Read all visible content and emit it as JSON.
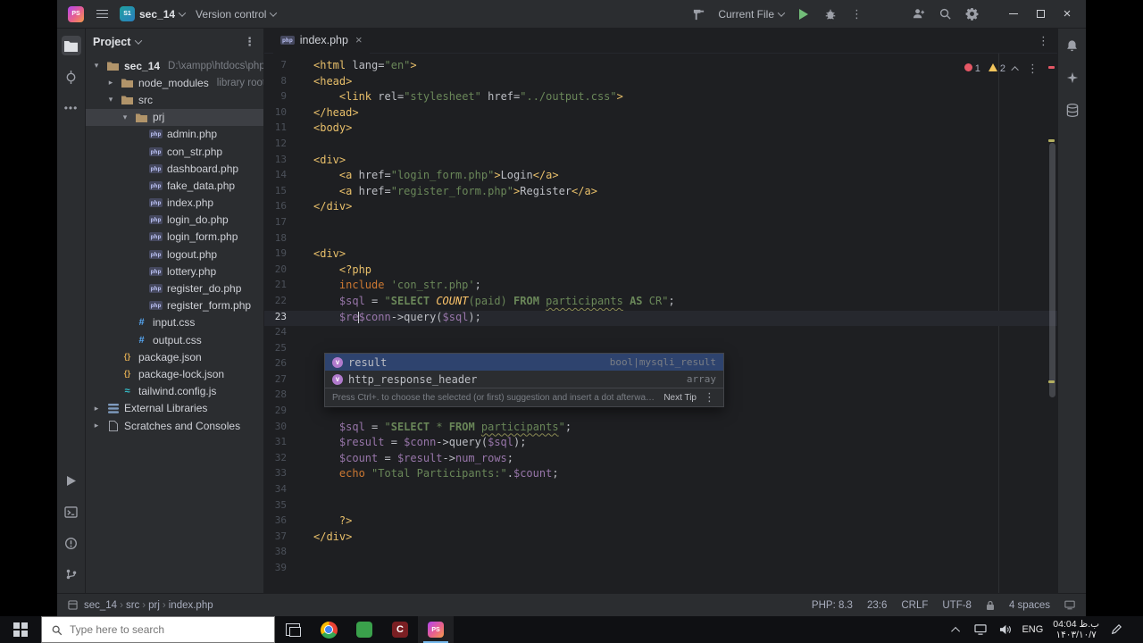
{
  "title_bar": {
    "project_initials": "S1",
    "project_name": "sec_14",
    "version_control_label": "Version control",
    "run_config_label": "Current File",
    "logo_text": "PS"
  },
  "editor_tabs": {
    "active_tab": "index.php",
    "active_tab_icon": "php"
  },
  "inspections": {
    "errors": "1",
    "warnings": "2"
  },
  "project_panel": {
    "header": "Project",
    "items": [
      {
        "label": "sec_14",
        "hint": "D:\\xampp\\htdocs\\php_c",
        "indent": 0,
        "type": "folder",
        "chevron": "open",
        "bold": true
      },
      {
        "label": "node_modules",
        "hint": "library root",
        "indent": 1,
        "type": "folder",
        "chevron": "closed"
      },
      {
        "label": "src",
        "indent": 1,
        "type": "folder",
        "chevron": "open"
      },
      {
        "label": "prj",
        "indent": 2,
        "type": "folder",
        "chevron": "open",
        "selected": true
      },
      {
        "label": "admin.php",
        "indent": 3,
        "type": "php"
      },
      {
        "label": "con_str.php",
        "indent": 3,
        "type": "php"
      },
      {
        "label": "dashboard.php",
        "indent": 3,
        "type": "php"
      },
      {
        "label": "fake_data.php",
        "indent": 3,
        "type": "php"
      },
      {
        "label": "index.php",
        "indent": 3,
        "type": "php"
      },
      {
        "label": "login_do.php",
        "indent": 3,
        "type": "php"
      },
      {
        "label": "login_form.php",
        "indent": 3,
        "type": "php"
      },
      {
        "label": "logout.php",
        "indent": 3,
        "type": "php"
      },
      {
        "label": "lottery.php",
        "indent": 3,
        "type": "php"
      },
      {
        "label": "register_do.php",
        "indent": 3,
        "type": "php"
      },
      {
        "label": "register_form.php",
        "indent": 3,
        "type": "php"
      },
      {
        "label": "input.css",
        "indent": 2,
        "type": "css"
      },
      {
        "label": "output.css",
        "indent": 2,
        "type": "css"
      },
      {
        "label": "package.json",
        "indent": 1,
        "type": "json"
      },
      {
        "label": "package-lock.json",
        "indent": 1,
        "type": "json"
      },
      {
        "label": "tailwind.config.js",
        "indent": 1,
        "type": "tw"
      },
      {
        "label": "External Libraries",
        "indent": 0,
        "type": "lib",
        "chevron": "closed"
      },
      {
        "label": "Scratches and Consoles",
        "indent": 0,
        "type": "scratch",
        "chevron": "closed"
      }
    ]
  },
  "editor": {
    "current_line": 23,
    "lines": [
      {
        "n": 7,
        "tk": [
          [
            "tag",
            "<html "
          ],
          [
            "attr",
            "lang"
          ],
          [
            "txt",
            "="
          ],
          [
            "str",
            "\"en\""
          ],
          [
            "tag",
            ">"
          ]
        ]
      },
      {
        "n": 8,
        "tk": [
          [
            "tag",
            "<head>"
          ]
        ]
      },
      {
        "n": 9,
        "tk": [
          [
            "txt",
            "    "
          ],
          [
            "tag",
            "<link "
          ],
          [
            "attr",
            "rel"
          ],
          [
            "txt",
            "="
          ],
          [
            "str",
            "\"stylesheet\""
          ],
          [
            "attr",
            " href"
          ],
          [
            "txt",
            "="
          ],
          [
            "str",
            "\"../output.css\""
          ],
          [
            "tag",
            ">"
          ]
        ]
      },
      {
        "n": 10,
        "tk": [
          [
            "tag",
            "</head>"
          ]
        ]
      },
      {
        "n": 11,
        "tk": [
          [
            "tag",
            "<body>"
          ]
        ]
      },
      {
        "n": 12,
        "tk": []
      },
      {
        "n": 13,
        "tk": [
          [
            "tag",
            "<div>"
          ]
        ]
      },
      {
        "n": 14,
        "tk": [
          [
            "txt",
            "    "
          ],
          [
            "tag",
            "<a "
          ],
          [
            "attr",
            "href"
          ],
          [
            "txt",
            "="
          ],
          [
            "str",
            "\"login_form.php\""
          ],
          [
            "tag",
            ">"
          ],
          [
            "txt",
            "Login"
          ],
          [
            "tag",
            "</a>"
          ]
        ]
      },
      {
        "n": 15,
        "tk": [
          [
            "txt",
            "    "
          ],
          [
            "tag",
            "<a "
          ],
          [
            "attr",
            "href"
          ],
          [
            "txt",
            "="
          ],
          [
            "str",
            "\"register_form.php\""
          ],
          [
            "tag",
            ">"
          ],
          [
            "txt",
            "Register"
          ],
          [
            "tag",
            "</a>"
          ]
        ]
      },
      {
        "n": 16,
        "tk": [
          [
            "tag",
            "</div>"
          ]
        ]
      },
      {
        "n": 17,
        "tk": []
      },
      {
        "n": 18,
        "tk": []
      },
      {
        "n": 19,
        "tk": [
          [
            "tag",
            "<div>"
          ]
        ]
      },
      {
        "n": 20,
        "tk": [
          [
            "txt",
            "    "
          ],
          [
            "php",
            "<?php"
          ]
        ]
      },
      {
        "n": 21,
        "tk": [
          [
            "txt",
            "    "
          ],
          [
            "kw",
            "include "
          ],
          [
            "str",
            "'con_str.php'"
          ],
          [
            "txt",
            ";"
          ]
        ]
      },
      {
        "n": 22,
        "tk": [
          [
            "txt",
            "    "
          ],
          [
            "var",
            "$sql"
          ],
          [
            "txt",
            " = "
          ],
          [
            "str",
            "\""
          ],
          [
            "sqlk",
            "SELECT "
          ],
          [
            "sqlf",
            "COUNT"
          ],
          [
            "str",
            "(paid) "
          ],
          [
            "sqlk",
            "FROM "
          ],
          [
            "stru",
            "participants"
          ],
          [
            "str",
            " "
          ],
          [
            "sqlk",
            "AS "
          ],
          [
            "str",
            "CR\""
          ],
          [
            "txt",
            ";"
          ]
        ]
      },
      {
        "n": 23,
        "tk": [
          [
            "txt",
            "    "
          ],
          [
            "var",
            "$re"
          ],
          [
            "caret",
            ""
          ],
          [
            "var",
            "$conn"
          ],
          [
            "txt",
            "->query("
          ],
          [
            "var",
            "$sql"
          ],
          [
            "txt",
            ");"
          ]
        ]
      },
      {
        "n": 24,
        "tk": []
      },
      {
        "n": 25,
        "tk": []
      },
      {
        "n": 26,
        "tk": []
      },
      {
        "n": 27,
        "tk": []
      },
      {
        "n": 28,
        "tk": []
      },
      {
        "n": 29,
        "tk": []
      },
      {
        "n": 30,
        "tk": [
          [
            "txt",
            "    "
          ],
          [
            "var",
            "$sql"
          ],
          [
            "txt",
            " = "
          ],
          [
            "str",
            "\""
          ],
          [
            "sqlk",
            "SELECT "
          ],
          [
            "str",
            "* "
          ],
          [
            "sqlk",
            "FROM "
          ],
          [
            "stru",
            "participants"
          ],
          [
            "str",
            "\""
          ],
          [
            "txt",
            ";"
          ]
        ]
      },
      {
        "n": 31,
        "tk": [
          [
            "txt",
            "    "
          ],
          [
            "var",
            "$result"
          ],
          [
            "txt",
            " = "
          ],
          [
            "var",
            "$conn"
          ],
          [
            "txt",
            "->query("
          ],
          [
            "var",
            "$sql"
          ],
          [
            "txt",
            ");"
          ]
        ]
      },
      {
        "n": 32,
        "tk": [
          [
            "txt",
            "    "
          ],
          [
            "var",
            "$count"
          ],
          [
            "txt",
            " = "
          ],
          [
            "var",
            "$result"
          ],
          [
            "txt",
            "->"
          ],
          [
            "var",
            "num_rows"
          ],
          [
            "txt",
            ";"
          ]
        ]
      },
      {
        "n": 33,
        "tk": [
          [
            "txt",
            "    "
          ],
          [
            "kw",
            "echo "
          ],
          [
            "str",
            "\"Total Participants:\""
          ],
          [
            "txt",
            "."
          ],
          [
            "var",
            "$count"
          ],
          [
            "txt",
            ";"
          ]
        ]
      },
      {
        "n": 34,
        "tk": []
      },
      {
        "n": 35,
        "tk": []
      },
      {
        "n": 36,
        "tk": [
          [
            "txt",
            "    "
          ],
          [
            "php",
            "?>"
          ]
        ]
      },
      {
        "n": 37,
        "tk": [
          [
            "tag",
            "</div>"
          ]
        ]
      },
      {
        "n": 38,
        "tk": []
      },
      {
        "n": 39,
        "tk": []
      }
    ]
  },
  "completion": {
    "items": [
      {
        "label": "result",
        "type": "bool|mysqli_result",
        "selected": true
      },
      {
        "label": "http_response_header",
        "type": "array"
      }
    ],
    "hint": "Press Ctrl+. to choose the selected (or first) suggestion and insert a dot afterwards",
    "next_tip": "Next Tip"
  },
  "status_bar": {
    "breadcrumbs": [
      "sec_14",
      "src",
      "prj",
      "index.php"
    ],
    "php_version": "PHP: 8.3",
    "caret_position": "23:6",
    "line_ending": "CRLF",
    "encoding": "UTF-8",
    "indent_setting": "4 spaces"
  },
  "taskbar": {
    "search_placeholder": "Type here to search",
    "language": "ENG",
    "time": "04:04 ب.ظ",
    "date": "۱۴۰۳/۱۰/۷"
  }
}
